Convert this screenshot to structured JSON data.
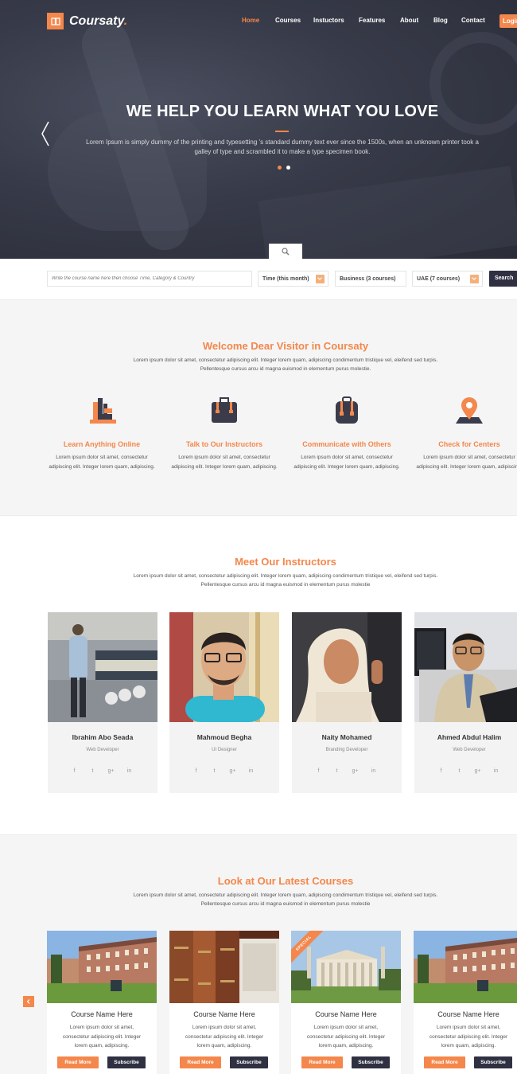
{
  "brand": {
    "name": "Coursaty",
    "dot": ".",
    "accent": "#f4874b",
    "dark": "#2f3142"
  },
  "nav": {
    "items": [
      "Home",
      "Courses",
      "Instuctors",
      "Features",
      "About",
      "Blog",
      "Contact"
    ],
    "active": "Home",
    "login": "Login"
  },
  "hero": {
    "title": "WE HELP YOU LEARN WHAT YOU LOVE",
    "text": "Lorem Ipsum is simply dummy of the printing and typesetting 's standard dummy text ever since the 1500s, when an unknown printer took a galley of type and scrambled it to make a type specimen book.",
    "slides": 2,
    "active_slide": 1
  },
  "search": {
    "placeholder": "Write the course name here then choose Time, Category & Country",
    "time": "Time (this month)",
    "category": "Business (3 courses)",
    "country": "UAE (7 courses)",
    "button": "Search"
  },
  "welcome": {
    "title": "Welcome Dear Visitor in Coursaty",
    "text": "Lorem ipsum dolor sit amet, consectetur adipiscing elit. Integer lorem quam, adipiscing condimentum tristique vel, eleifend sed turpis. Pellentesque cursus arcu id magna euismod in elementum purus molestie.",
    "features": [
      {
        "title": "Learn Anything Online",
        "icon": "books-icon",
        "text": "Lorem ipsum dolor sit amet, consectetur adipiscing elit. Integer lorem quam, adipiscing."
      },
      {
        "title": "Talk to Our Instructors",
        "icon": "briefcase-icon",
        "text": "Lorem ipsum dolor sit amet, consectetur adipiscing elit. Integer lorem quam, adipiscing."
      },
      {
        "title": "Communicate with Others",
        "icon": "backpack-icon",
        "text": "Lorem ipsum dolor sit amet, consectetur adipiscing elit. Integer lorem quam, adipiscing."
      },
      {
        "title": "Check for Centers",
        "icon": "location-pin-icon",
        "text": "Lorem ipsum dolor sit amet, consectetur adipiscing elit. Integer lorem quam, adipiscing."
      }
    ]
  },
  "instructors": {
    "title": "Meet Our Instructors",
    "text": "Lorem ipsum dolor sit amet, consectetur adipiscing elit. Integer lorem quam, adipiscing condimentum tristique vel, eleifend sed turpis. Pellentesque cursus arcu id magna euismod in elementum purus molestie",
    "social": [
      "f",
      "t",
      "g+",
      "in"
    ],
    "people": [
      {
        "name": "Ibrahim Abo Seada",
        "role": "Web Developer"
      },
      {
        "name": "Mahmoud Begha",
        "role": "UI Designer"
      },
      {
        "name": "Naity Mohamed",
        "role": "Branding Developer"
      },
      {
        "name": "Ahmed Abdul Halim",
        "role": "Web Developer"
      }
    ]
  },
  "courses": {
    "title": "Look at Our Latest Courses",
    "text": "Lorem ipsum dolor sit amet, consectetur adipiscing elit. Integer lorem quam, adipiscing condimentum tristique vel, eleifend sed turpis. Pellentesque cursus arcu id magna euismod in elementum purus molestie",
    "special_label": "SPECIAL",
    "read_more": "Read More",
    "subscribe": "Subscribe",
    "items": [
      {
        "name": "Course Name Here",
        "text": "Lorem ipsum dolor sit amet, consectetur adipiscing elit. Integer lorem quam, adipiscing."
      },
      {
        "name": "Course Name Here",
        "text": "Lorem ipsum dolor sit amet, consectetur adipiscing elit. Integer lorem quam, adipiscing."
      },
      {
        "name": "Course Name Here",
        "text": "Lorem ipsum dolor sit amet, consectetur adipiscing elit. Integer lorem quam, adipiscing."
      },
      {
        "name": "Course Name Here",
        "text": "Lorem ipsum dolor sit amet, consectetur adipiscing elit. Integer lorem quam, adipiscing."
      }
    ]
  }
}
